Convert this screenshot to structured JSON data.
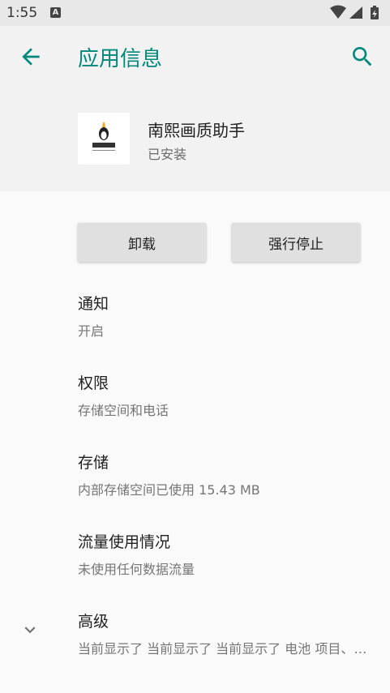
{
  "status_bar": {
    "time": "1:55",
    "notification_letter": "A",
    "icons": [
      "wifi-icon",
      "cell-signal-icon",
      "battery-charging-icon"
    ]
  },
  "header": {
    "title": "应用信息",
    "back_icon": "arrow-left-icon",
    "search_icon": "search-icon",
    "accent_color": "#00897b"
  },
  "app": {
    "name": "南熙画质助手",
    "status": "已安装"
  },
  "actions": {
    "uninstall_label": "卸载",
    "force_stop_label": "强行停止"
  },
  "preferences": [
    {
      "title": "通知",
      "summary": "开启"
    },
    {
      "title": "权限",
      "summary": "存储空间和电话"
    },
    {
      "title": "存储",
      "summary": "内部存储空间已使用 15.43 MB"
    },
    {
      "title": "流量使用情况",
      "summary": "未使用任何数据流量"
    },
    {
      "title": "高级",
      "summary": "当前显示了 当前显示了 当前显示了 电池 项目、默认打开"
    }
  ]
}
